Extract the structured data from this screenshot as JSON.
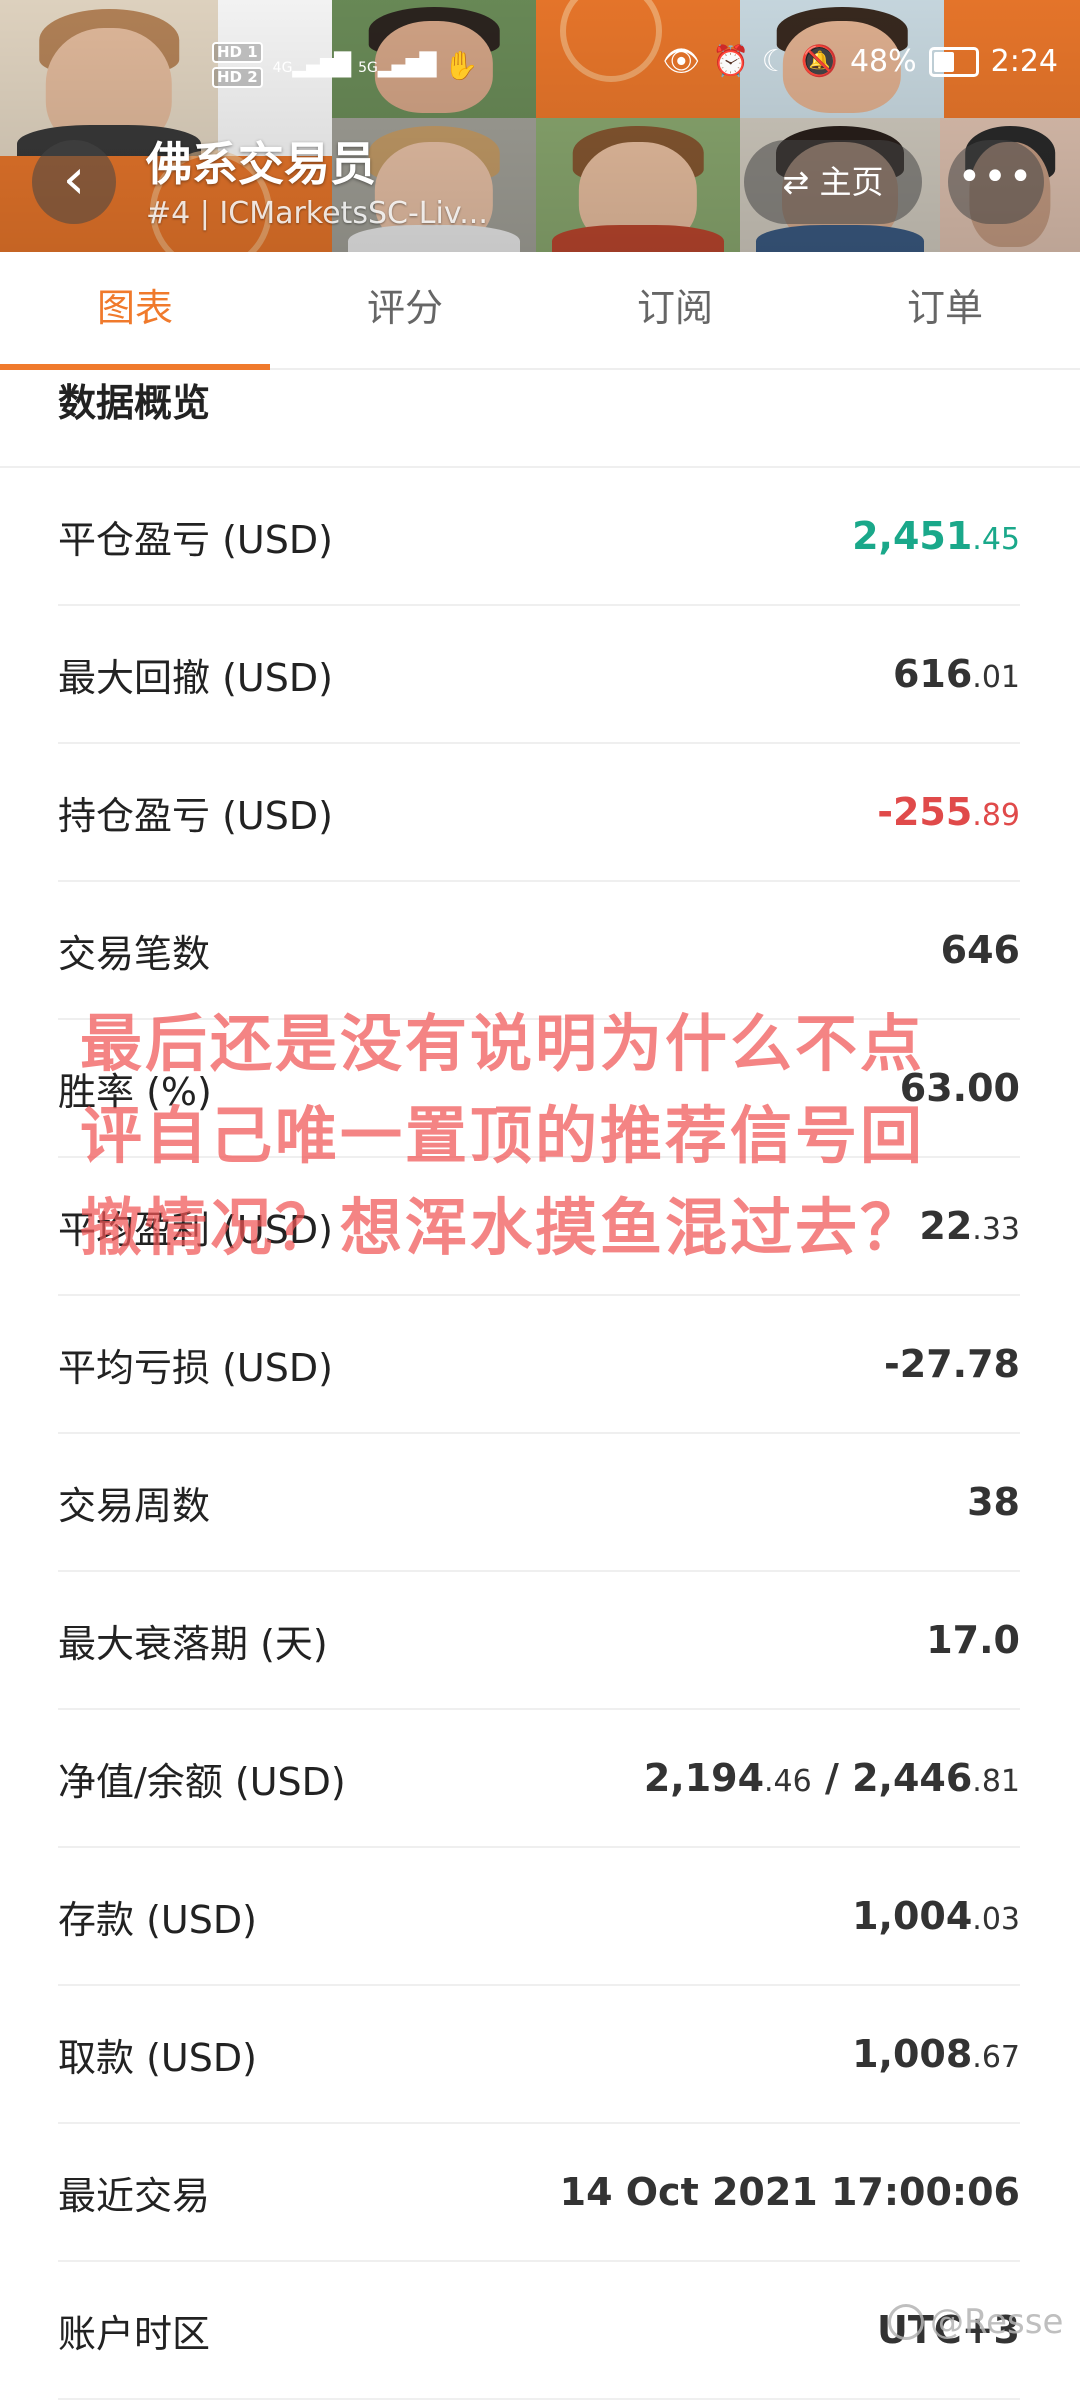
{
  "status_bar": {
    "hd1": "HD 1",
    "hd2": "HD 2",
    "net1": "4G",
    "net2": "5G",
    "battery": "48%",
    "time": "2:24"
  },
  "header": {
    "title": "佛系交易员",
    "subtitle": "#4 | ICMarketsSC-Liv...",
    "home_label": "主页",
    "more_label": "•••"
  },
  "tabs": [
    {
      "label": "图表",
      "active": true
    },
    {
      "label": "评分",
      "active": false
    },
    {
      "label": "订阅",
      "active": false
    },
    {
      "label": "订单",
      "active": false
    }
  ],
  "section_title": "数据概览",
  "rows": [
    {
      "label": "平仓盈亏 (USD)",
      "int": "2,451",
      "dec": ".45",
      "tone": "pos"
    },
    {
      "label": "最大回撤 (USD)",
      "int": "616",
      "dec": ".01",
      "tone": ""
    },
    {
      "label": "持仓盈亏 (USD)",
      "int": "-255",
      "dec": ".89",
      "tone": "neg"
    },
    {
      "label": "交易笔数",
      "int": "646",
      "dec": "",
      "tone": ""
    },
    {
      "label": "胜率 (%)",
      "int": "63.00",
      "dec": "",
      "tone": ""
    },
    {
      "label": "平均盈利 (USD)",
      "int": "22",
      "dec": ".33",
      "tone": ""
    },
    {
      "label": "平均亏损 (USD)",
      "int": "-27.78",
      "dec": "",
      "tone": ""
    },
    {
      "label": "交易周数",
      "int": "38",
      "dec": "",
      "tone": ""
    },
    {
      "label": "最大衰落期 (天)",
      "int": "17.0",
      "dec": "",
      "tone": ""
    },
    {
      "label": "净值/余额 (USD)",
      "int": "2,194",
      "dec": ".46",
      "int2": " / 2,446",
      "dec2": ".81",
      "tone": ""
    },
    {
      "label": "存款 (USD)",
      "int": "1,004",
      "dec": ".03",
      "tone": ""
    },
    {
      "label": "取款 (USD)",
      "int": "1,008",
      "dec": ".67",
      "tone": ""
    },
    {
      "label": "最近交易",
      "int": "14 Oct 2021 17:00:06",
      "dec": "",
      "tone": ""
    },
    {
      "label": "账户时区",
      "int": "UTC+3",
      "dec": "",
      "tone": ""
    }
  ],
  "overlay_text": "最后还是没有说明为什么不点评自己唯一置顶的推荐信号回撤情况？想浑水摸鱼混过去？",
  "watermark": "@Resse",
  "colors": {
    "accent": "#f07a2c",
    "positive": "#1aa88a",
    "negative": "#e04a4a",
    "overlay": "#f05555"
  }
}
